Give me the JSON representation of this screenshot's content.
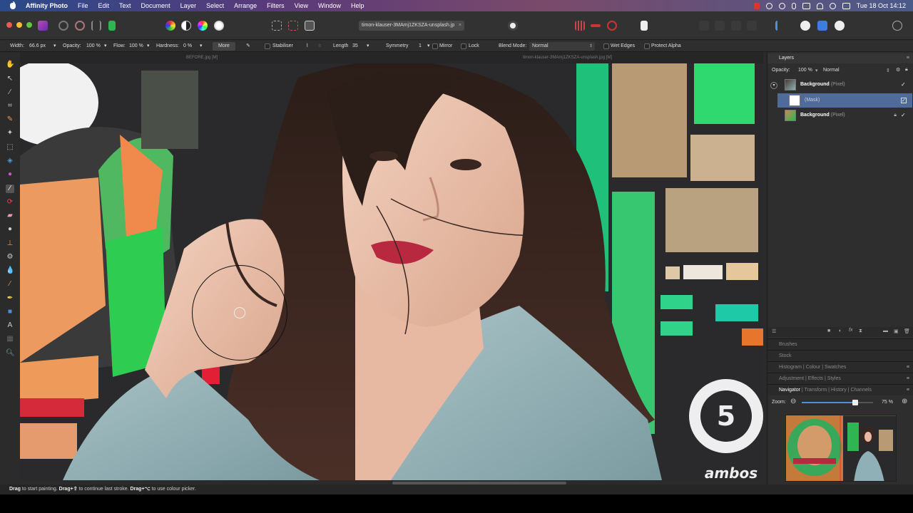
{
  "menubar": {
    "app_name": "Affinity Photo",
    "items": [
      "File",
      "Edit",
      "Text",
      "Document",
      "Layer",
      "Select",
      "Arrange",
      "Filters",
      "View",
      "Window",
      "Help"
    ],
    "clock": "Tue 18 Oct  14:12"
  },
  "toolbar": {
    "document_tab": "timon-klauser-3MAmj1ZKSZA-unsplash.jp",
    "close_glyph": "×"
  },
  "context_toolbar": {
    "width_label": "Width:",
    "width_value": "66.6 px",
    "opacity_label": "Opacity:",
    "opacity_value": "100 %",
    "flow_label": "Flow:",
    "flow_value": "100 %",
    "hardness_label": "Hardness:",
    "hardness_value": "0 %",
    "more_label": "More",
    "stabiliser_label": "Stabiliser",
    "length_label": "Length",
    "length_value": "35",
    "symmetry_label": "Symmetry",
    "symmetry_value": "1",
    "mirror_label": "Mirror",
    "lock_label": "Lock",
    "blend_mode_label": "Blend Mode:",
    "blend_mode_value": "Normal",
    "wet_edges_label": "Wet Edges",
    "protect_alpha_label": "Protect Alpha"
  },
  "canvas": {
    "before_label": "BEFORE.jpg [M]",
    "document_label": "timon-klauser-3MAmj1ZKSZA-unsplash.jpg [M]",
    "badge_number": "5",
    "badge_text": "ambos"
  },
  "layers_panel": {
    "title": "Layers",
    "opacity_label": "Opacity:",
    "opacity_value": "100 %",
    "blend_value": "Normal",
    "layers": [
      {
        "name": "Background",
        "type": "(Pixel)"
      },
      {
        "name": "",
        "type": "(Mask)"
      },
      {
        "name": "Background",
        "type": "(Pixel)"
      }
    ]
  },
  "studio_panels": {
    "brushes": "Brushes",
    "stock": "Stock",
    "histogram": "Histogram",
    "colour": "Colour",
    "swatches": "Swatches",
    "adjustment": "Adjustment",
    "effects": "Effects",
    "styles": "Styles",
    "navigator": "Navigator",
    "transform": "Transform",
    "history": "History",
    "channels": "Channels",
    "separator": "|"
  },
  "navigator": {
    "zoom_label": "Zoom:",
    "zoom_value": "75 %",
    "zoom_fraction": 0.75
  },
  "statusbar": {
    "drag1": "Drag",
    "text1": " to start painting. ",
    "drag2": "Drag+⇧",
    "text2": " to continue last stroke. ",
    "drag3": "Drag+⌥",
    "text3": " to use colour picker."
  },
  "colors": {
    "accent": "#4f6b9a",
    "graffiti_green": "#2fb552",
    "coat": "#8fb0b6",
    "lips": "#b8283e"
  }
}
